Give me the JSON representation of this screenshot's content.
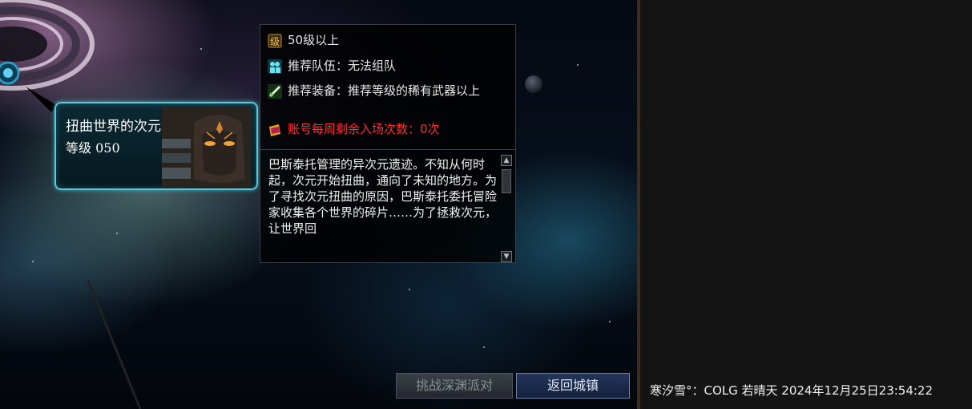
{
  "dungeon": {
    "name": "扭曲世界的次元",
    "level": "等级 050"
  },
  "info": {
    "level_req": "50级以上",
    "team": "推荐队伍：无法组队",
    "gear": "推荐装备：推荐等级的稀有武器以上",
    "entries": "账号每周剩余入场次数：0次",
    "description": "巴斯泰托管理的异次元遗迹。不知从何时起，次元开始扭曲，通向了未知的地方。为了寻找次元扭曲的原因，巴斯泰托委托冒险家收集各个世界的碎片……为了拯救次元，让世界回"
  },
  "icons": {
    "level": "level-badge-icon",
    "team": "party-icon",
    "gear": "sword-icon",
    "entries": "ticket-icon",
    "scroll_up": "scroll-up-icon",
    "scroll_down": "scroll-down-icon"
  },
  "buttons": {
    "abyss": "挑战深渊派对",
    "return": "返回城镇"
  },
  "chat": {
    "line": "寒汐雪°：COLG 若晴天 2024年12月25日23:54:22"
  },
  "colors": {
    "warning_text": "#ff2f2f",
    "card_border": "#5bc9d6",
    "button_blue": "#14213b"
  }
}
